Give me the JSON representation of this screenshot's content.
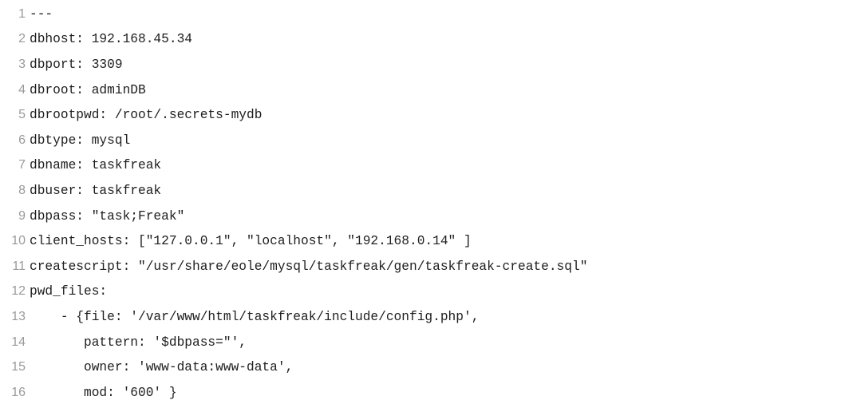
{
  "editor": {
    "lines": [
      {
        "number": "1",
        "text": "---"
      },
      {
        "number": "2",
        "text": "dbhost: 192.168.45.34"
      },
      {
        "number": "3",
        "text": "dbport: 3309"
      },
      {
        "number": "4",
        "text": "dbroot: adminDB"
      },
      {
        "number": "5",
        "text": "dbrootpwd: /root/.secrets-mydb"
      },
      {
        "number": "6",
        "text": "dbtype: mysql"
      },
      {
        "number": "7",
        "text": "dbname: taskfreak"
      },
      {
        "number": "8",
        "text": "dbuser: taskfreak"
      },
      {
        "number": "9",
        "text": "dbpass: \"task;Freak\""
      },
      {
        "number": "10",
        "text": "client_hosts: [\"127.0.0.1\", \"localhost\", \"192.168.0.14\" ]"
      },
      {
        "number": "11",
        "text": "createscript: \"/usr/share/eole/mysql/taskfreak/gen/taskfreak-create.sql\""
      },
      {
        "number": "12",
        "text": "pwd_files:"
      },
      {
        "number": "13",
        "text": "    - {file: '/var/www/html/taskfreak/include/config.php',"
      },
      {
        "number": "14",
        "text": "       pattern: '$dbpass=\"',"
      },
      {
        "number": "15",
        "text": "       owner: 'www-data:www-data',"
      },
      {
        "number": "16",
        "text": "       mod: '600' }"
      }
    ]
  }
}
